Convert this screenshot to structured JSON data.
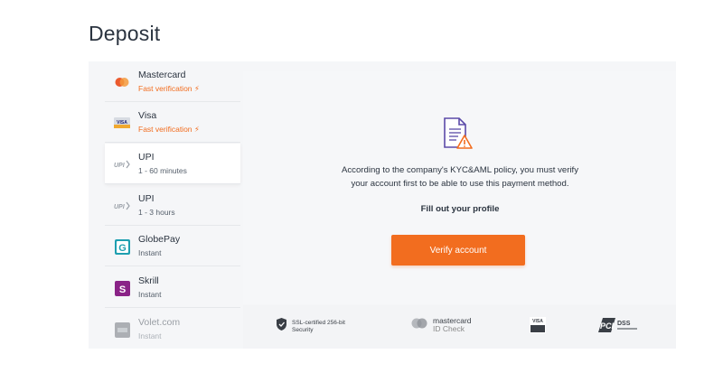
{
  "page": {
    "title": "Deposit"
  },
  "methods": [
    {
      "name": "Mastercard",
      "sub": "Fast verification ⚡",
      "icon": "mastercard-icon",
      "promo": true
    },
    {
      "name": "Visa",
      "sub": "Fast verification ⚡",
      "icon": "visa-icon",
      "promo": true
    },
    {
      "name": "UPI",
      "sub": "1 - 60 minutes",
      "icon": "upi-icon",
      "promo": false
    },
    {
      "name": "UPI",
      "sub": "1 - 3 hours",
      "icon": "upi-icon",
      "promo": false
    },
    {
      "name": "GlobePay",
      "sub": "Instant",
      "icon": "globepay-icon",
      "promo": false
    },
    {
      "name": "Skrill",
      "sub": "Instant",
      "icon": "skrill-icon",
      "promo": false
    },
    {
      "name": "Volet.com",
      "sub": "Instant",
      "icon": "volet-icon",
      "promo": false
    }
  ],
  "main": {
    "policy_text": "According to the company's KYC&AML policy, you must verify your account first to be able to use this payment method.",
    "fill_profile": "Fill out your profile",
    "verify_button": "Verify account"
  },
  "badges": {
    "ssl_line1": "SSL-certified 256-bit",
    "ssl_line2": "Security",
    "mc_line1": "mastercard",
    "mc_line2": "ID Check",
    "visa_label": "VISA",
    "pci_label": "DSS"
  },
  "colors": {
    "accent": "#f26d1f",
    "doc_purple": "#5b4aa8"
  }
}
